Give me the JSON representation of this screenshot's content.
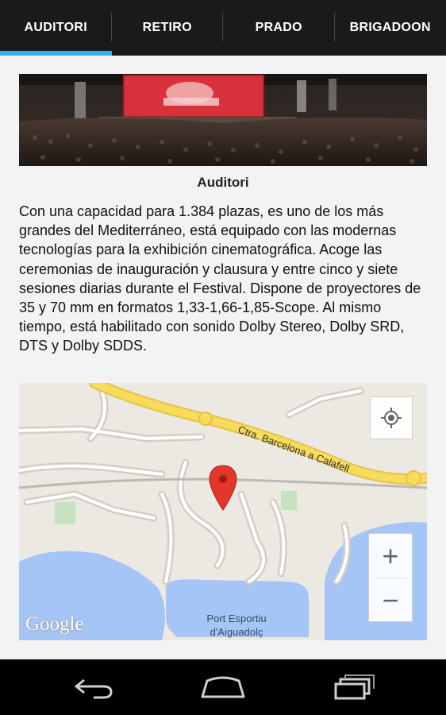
{
  "tabs": [
    {
      "label": "AUDITORI",
      "active": true
    },
    {
      "label": "RETIRO",
      "active": false
    },
    {
      "label": "PRADO",
      "active": false
    },
    {
      "label": "BRIGADOON",
      "active": false
    }
  ],
  "venue": {
    "image_alt": "Auditori",
    "caption": "Auditori",
    "description": "Con una capacidad para 1.384 plazas, es uno de los más grandes del Mediterráneo, está equipado con las modernas tecnologías para la exhibición cinematográfica. Acoge las ceremonias de inauguración y clausura y entre cinco y siete sesiones diarias durante el Festival. Dispone de proyectores de 35 y 70 mm en formatos 1,33-1,66-1,85-Scope. Al mismo tiempo, está habilitado con sonido Dolby Stereo, Dolby SRD, DTS y Dolby SDDS."
  },
  "map": {
    "road_label": "Ctra. Barcelona a Calafell",
    "port_label_line1": "Port Esportiu",
    "port_label_line2": "d'Aiguadolç",
    "logo_text": "Google",
    "zoom_in": "+",
    "zoom_out": "−",
    "icons": [
      "my-location-icon",
      "map-pin-icon"
    ],
    "colors": {
      "water": "#a4c5f6",
      "road_major": "#f7dc5b",
      "land": "#ece8e2",
      "park": "#c5e3bf",
      "pin": "#e3372b"
    }
  },
  "navbar": {
    "icons": [
      "back-icon",
      "home-icon",
      "recent-apps-icon"
    ]
  },
  "colors": {
    "tab_indicator": "#33b5e5",
    "tab_bar": "#1a1a1a"
  }
}
